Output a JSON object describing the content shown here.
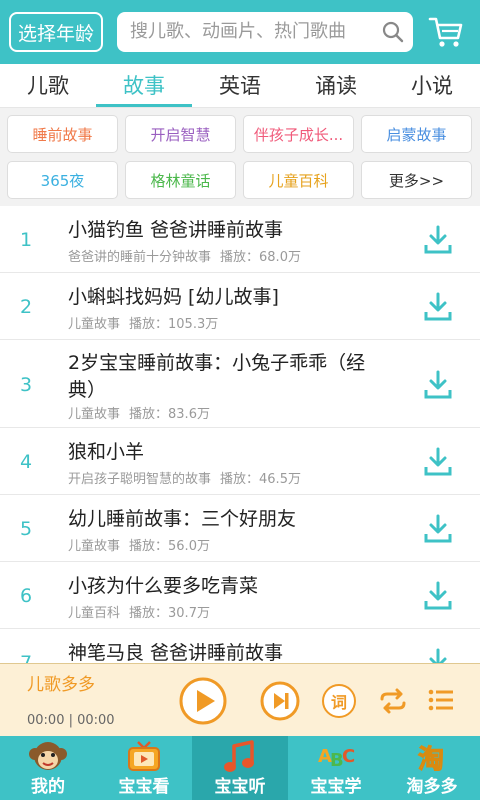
{
  "header": {
    "age_button": "选择年龄",
    "search_placeholder": "搜儿歌、动画片、热门歌曲"
  },
  "tabs": [
    "儿歌",
    "故事",
    "英语",
    "诵读",
    "小说"
  ],
  "active_tab": "故事",
  "categories": [
    {
      "label": "睡前故事",
      "color": "#f07a4a"
    },
    {
      "label": "开启智慧",
      "color": "#9a5fc0"
    },
    {
      "label": "伴孩子成长...",
      "color": "#f05a7a"
    },
    {
      "label": "启蒙故事",
      "color": "#4a8fe0"
    },
    {
      "label": "365夜",
      "color": "#3ab0e0"
    },
    {
      "label": "格林童话",
      "color": "#4cb84c"
    },
    {
      "label": "儿童百科",
      "color": "#e6a21e"
    },
    {
      "label": "更多>>",
      "color": "#333333"
    }
  ],
  "stories": [
    {
      "num": "1",
      "title": "小猫钓鱼  爸爸讲睡前故事",
      "source": "爸爸讲的睡前十分钟故事",
      "plays_label": "播放：68.0万"
    },
    {
      "num": "2",
      "title": "小蝌蚪找妈妈 [幼儿故事]",
      "source": "儿童故事",
      "plays_label": "播放：105.3万"
    },
    {
      "num": "3",
      "title": "2岁宝宝睡前故事：小兔子乖乖（经典）",
      "source": "儿童故事",
      "plays_label": "播放：83.6万"
    },
    {
      "num": "4",
      "title": "狼和小羊",
      "source": "开启孩子聪明智慧的故事",
      "plays_label": "播放：46.5万"
    },
    {
      "num": "5",
      "title": "幼儿睡前故事：三个好朋友",
      "source": "儿童故事",
      "plays_label": "播放：56.0万"
    },
    {
      "num": "6",
      "title": "小孩为什么要多吃青菜",
      "source": "儿童百科",
      "plays_label": "播放：30.7万"
    },
    {
      "num": "7",
      "title": "神笔马良  爸爸讲睡前故事",
      "source": "",
      "plays_label": ""
    }
  ],
  "player": {
    "title": "儿歌多多",
    "time": "00:00 | 00:00",
    "lyrics_glyph": "词",
    "accent_color": "#f09a26"
  },
  "nav": [
    {
      "label": "我的",
      "icon": "monkey-icon"
    },
    {
      "label": "宝宝看",
      "icon": "tv-icon"
    },
    {
      "label": "宝宝听",
      "icon": "music-note-icon"
    },
    {
      "label": "宝宝学",
      "icon": "abc-icon"
    },
    {
      "label": "淘多多",
      "icon": "tao-icon"
    }
  ],
  "nav_active": "宝宝听",
  "nav_icon_glyphs": {
    "tao": "淘",
    "abc_a": "A",
    "abc_b": "B",
    "abc_c": "C"
  },
  "colors": {
    "theme": "#3ec2c6",
    "player_bg": "#fdf0d6"
  }
}
